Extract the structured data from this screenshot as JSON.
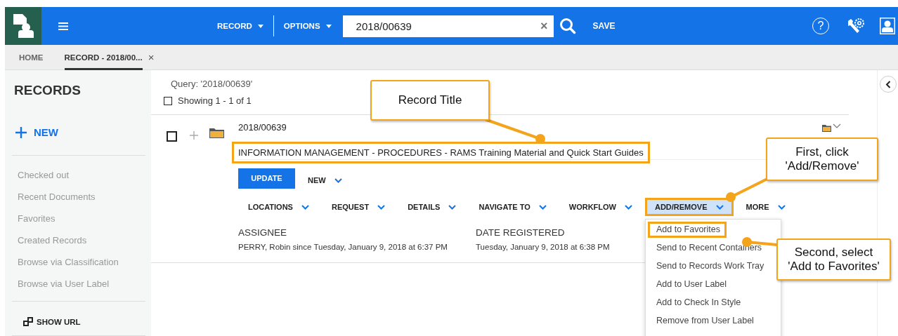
{
  "header": {
    "nav": [
      {
        "label": "RECORD"
      },
      {
        "label": "OPTIONS"
      }
    ],
    "search": {
      "value": "2018/00639",
      "clear": "×"
    },
    "save": "SAVE",
    "help": "?"
  },
  "tabs": [
    {
      "label": "HOME",
      "selected": false
    },
    {
      "label": "RECORD - 2018/00...",
      "selected": true,
      "close": "×"
    }
  ],
  "sidebar": {
    "title": "RECORDS",
    "new_label": "NEW",
    "items": [
      "Checked out",
      "Recent Documents",
      "Favorites",
      "Created Records",
      "Browse via Classification",
      "Browse via User Label"
    ],
    "show_url": "SHOW URL"
  },
  "results": {
    "query": "Query: '2018/00639'",
    "showing": "Showing 1 - 1 of 1",
    "all_checked": false
  },
  "record": {
    "checked": false,
    "number": "2018/00639",
    "title": "INFORMATION MANAGEMENT - PROCEDURES - RAMS Training Material and Quick Start Guides",
    "title_highlighted": true,
    "update": "UPDATE",
    "new": "NEW",
    "actions": [
      {
        "label": "LOCATIONS",
        "selected": false
      },
      {
        "label": "REQUEST",
        "selected": false
      },
      {
        "label": "DETAILS",
        "selected": false
      },
      {
        "label": "NAVIGATE TO",
        "selected": false
      },
      {
        "label": "WORKFLOW",
        "selected": false
      },
      {
        "label": "ADD/REMOVE",
        "selected": true
      },
      {
        "label": "MORE",
        "selected": false
      }
    ],
    "fields": [
      {
        "label": "ASSIGNEE",
        "value": "PERRY, Robin since Tuesday, January 9, 2018 at 6:37 PM"
      },
      {
        "label": "DATE REGISTERED",
        "value": "Tuesday, January 9, 2018 at 6:38 PM"
      }
    ]
  },
  "menu": {
    "items": [
      {
        "label": "Add to Favorites",
        "highlighted": true
      },
      {
        "label": "Send to Recent Containers",
        "highlighted": false
      },
      {
        "label": "Send to Records Work Tray",
        "highlighted": false
      },
      {
        "label": "Add to User Label",
        "highlighted": false
      },
      {
        "label": "Add to Check In Style",
        "highlighted": false
      },
      {
        "label": "Remove from User Label",
        "highlighted": false
      }
    ]
  },
  "callouts": [
    {
      "text": "Record Title"
    },
    {
      "text": "First, click\n'Add/Remove'"
    },
    {
      "text": "Second, select\n'Add to Favorites'"
    }
  ]
}
